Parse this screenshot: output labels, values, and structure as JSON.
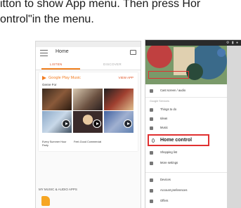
{
  "instruction": {
    "line1": "itton to show App menu. Then press  Hor",
    "line2": "ontrol\"in the menu."
  },
  "left_phone": {
    "app_title": "Home",
    "tabs": [
      {
        "label": "LISTEN",
        "active": true
      },
      {
        "label": "DISCOVER",
        "active": false
      }
    ],
    "card": {
      "service": "Google Play Music",
      "action": "VIEW APP",
      "subtitle": "Genre For",
      "tile_labels": [
        "Every Summer Hour Party",
        "Feel-Good Commercial"
      ]
    },
    "section_title": "MY MUSIC & AUDIO APPS"
  },
  "right_phone": {
    "status_icons": "⚙ ▮ ●",
    "menu": {
      "account_label": "Cast screen / audio",
      "section_label": "Google Services",
      "items": [
        {
          "icon": "gear-icon",
          "label": "Things to do"
        },
        {
          "icon": "bulb-icon",
          "label": "Ideas"
        },
        {
          "icon": "music-icon",
          "label": "Music"
        }
      ],
      "highlighted_item": {
        "icon": "location-pin-icon",
        "label": "Home control"
      },
      "after_items": [
        {
          "icon": "cart-icon",
          "label": "Shopping list"
        },
        {
          "icon": "settings-icon",
          "label": "More settings"
        }
      ],
      "bottom_items": [
        {
          "icon": "devices-icon",
          "label": "Devices"
        },
        {
          "icon": "account-icon",
          "label": "Account preferences"
        },
        {
          "icon": "offers-icon",
          "label": "Offers"
        }
      ]
    }
  },
  "colors": {
    "accent_orange": "#f27c20",
    "highlight_red": "#e03030",
    "header_green": "#6a8a5a"
  }
}
